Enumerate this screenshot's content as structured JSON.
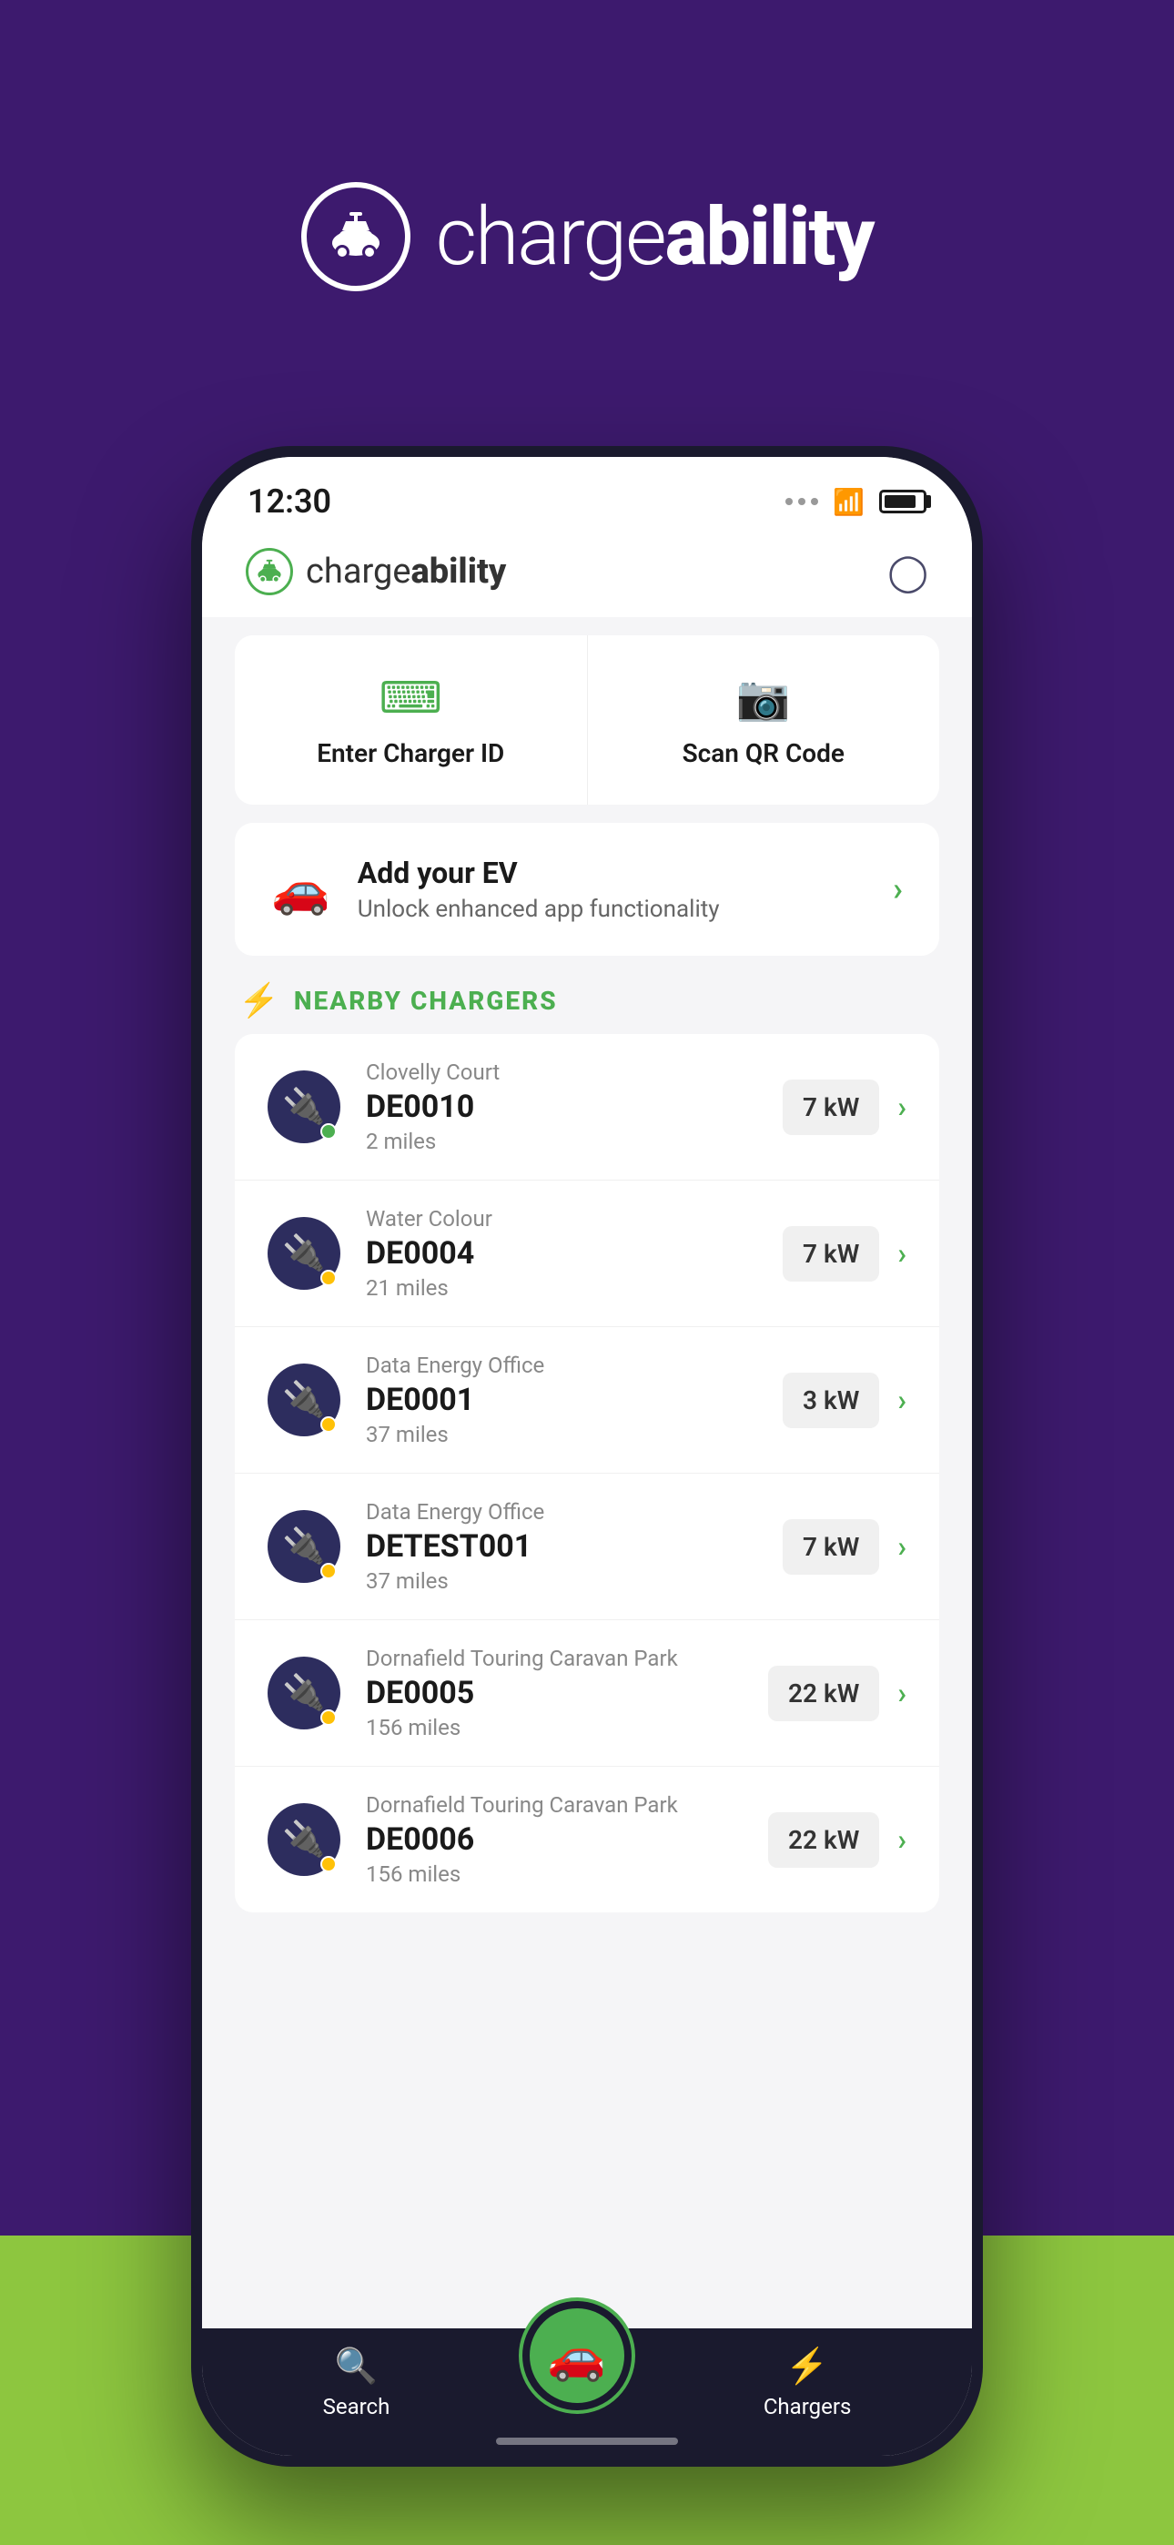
{
  "background_color": "#3d1a6e",
  "green_accent": "#4caf50",
  "logo": {
    "text_light": "charge",
    "text_bold": "ability"
  },
  "status_bar": {
    "time": "12:30"
  },
  "header": {
    "logo_light": "charge",
    "logo_bold": "ability",
    "profile_icon": "person"
  },
  "quick_actions": [
    {
      "label": "Enter Charger ID",
      "icon": "keyboard"
    },
    {
      "label": "Scan QR Code",
      "icon": "camera"
    }
  ],
  "add_ev": {
    "title": "Add your EV",
    "subtitle": "Unlock enhanced app functionality",
    "chevron": "›"
  },
  "nearby_section": {
    "title": "NEARBY CHARGERS"
  },
  "chargers": [
    {
      "location": "Clovelly Court",
      "id": "DE0010",
      "distance": "2 miles",
      "power": "7 kW",
      "status": "green"
    },
    {
      "location": "Water Colour",
      "id": "DE0004",
      "distance": "21 miles",
      "power": "7 kW",
      "status": "yellow"
    },
    {
      "location": "Data Energy Office",
      "id": "DE0001",
      "distance": "37 miles",
      "power": "3 kW",
      "status": "yellow"
    },
    {
      "location": "Data Energy Office",
      "id": "DETEST001",
      "distance": "37 miles",
      "power": "7 kW",
      "status": "yellow"
    },
    {
      "location": "Dornafield Touring Caravan Park",
      "id": "DE0005",
      "distance": "156 miles",
      "power": "22 kW",
      "status": "yellow"
    },
    {
      "location": "Dornafield Touring Caravan Park",
      "id": "DE0006",
      "distance": "156 miles",
      "power": "22 kW",
      "status": "yellow"
    }
  ],
  "bottom_nav": {
    "search_label": "Search",
    "chargers_label": "Chargers"
  }
}
